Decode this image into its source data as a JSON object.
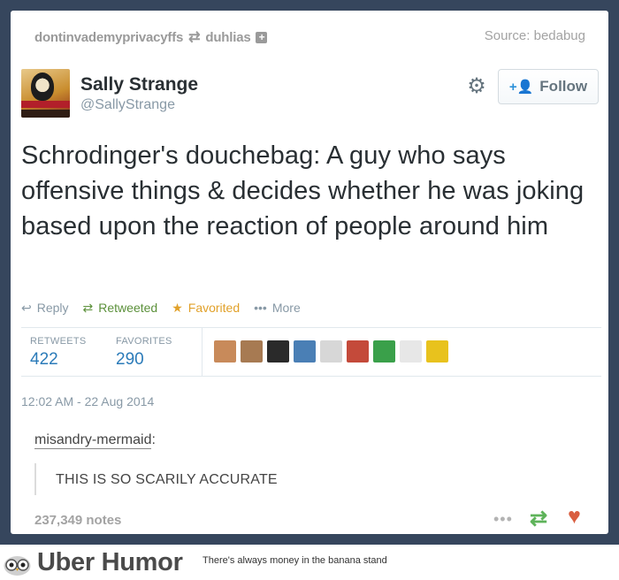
{
  "header": {
    "reblog_from": "dontinvademyprivacyffs",
    "reblog_to": "duhlias",
    "source": "Source: bedabug"
  },
  "tweet": {
    "name": "Sally Strange",
    "handle": "@SallyStrange",
    "follow_label": "Follow",
    "text": "Schrodinger's douchebag: A guy who says offensive things & decides whether he was joking based upon the reaction of people around him",
    "actions": {
      "reply": "Reply",
      "retweeted": "Retweeted",
      "favorited": "Favorited",
      "more": "More"
    },
    "stats": {
      "retweets_label": "RETWEETS",
      "retweets": "422",
      "favorites_label": "FAVORITES",
      "favorites": "290"
    },
    "timestamp": "12:02 AM - 22 Aug 2014",
    "favoriter_avatars": [
      "#c88a5a",
      "#a77a52",
      "#2a2a2a",
      "#4a7fb5",
      "#d7d7d7",
      "#c44a3a",
      "#3aa04a",
      "#e7e7e7",
      "#e8c21d"
    ]
  },
  "comment": {
    "user": "misandry-mermaid",
    "text": "THIS IS SO SCARILY ACCURATE"
  },
  "footer": {
    "notes": "237,349 notes"
  },
  "brand": {
    "name": "Uber Humor",
    "tagline": "There's always money in the banana stand"
  },
  "colors": {
    "background": "#36465d",
    "link_blue": "#2b7bb9",
    "retweet_green": "#5c913b",
    "favorite_gold": "#e1a12a",
    "heart": "#d95e40"
  }
}
